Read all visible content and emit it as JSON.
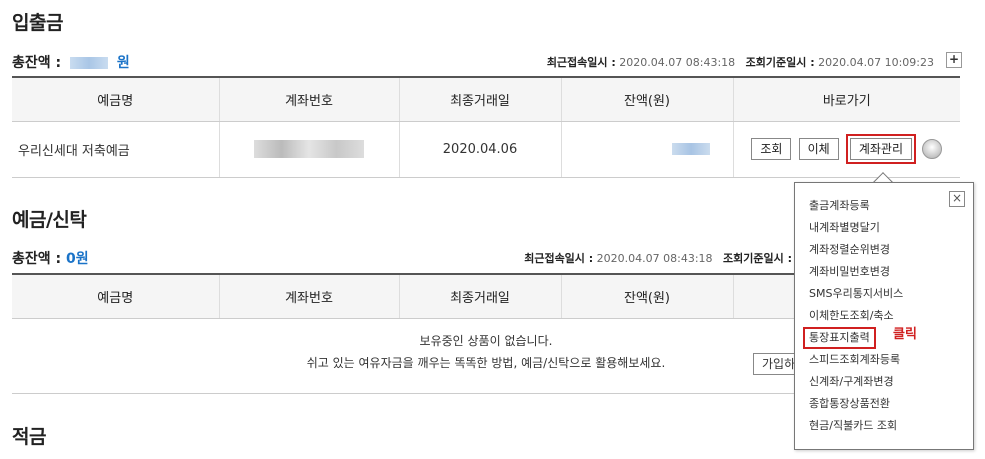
{
  "deposit_withdraw": {
    "title": "입출금",
    "total_label": "총잔액 :",
    "currency": "원",
    "last_access_label": "최근접속일시 :",
    "last_access": "2020.04.07 08:43:18",
    "query_label": "조회기준일시 :",
    "query_time": "2020.04.07 10:09:23",
    "plus": "+",
    "columns": [
      "예금명",
      "계좌번호",
      "최종거래일",
      "잔액(원)",
      "바로가기"
    ],
    "rows": [
      {
        "name": "우리신세대 저축예금",
        "last_date": "2020.04.06",
        "btn_inquiry": "조회",
        "btn_transfer": "이체",
        "btn_manage": "계좌관리"
      }
    ]
  },
  "savings_trust": {
    "title": "예금/신탁",
    "total_label": "총잔액 :",
    "total_value": "0원",
    "last_access_label": "최근접속일시 :",
    "last_access": "2020.04.07 08:43:18",
    "query_label": "조회기준일시 :",
    "columns": [
      "예금명",
      "계좌번호",
      "최종거래일",
      "잔액(원)"
    ],
    "empty_line1": "보유중인 상품이 없습니다.",
    "empty_line2": "쉬고 있는 여유자금을 깨우는 똑똑한 방법, 예금/신탁으로 활용해보세요.",
    "join_button": "가입하"
  },
  "installment": {
    "title": "적금"
  },
  "account_menu": {
    "close": "×",
    "items": [
      "출금계좌등록",
      "내계좌별명달기",
      "계좌정렬순위변경",
      "계좌비밀번호변경",
      "SMS우리통지서비스",
      "이체한도조회/축소",
      "통장표지출력",
      "스피드조회계좌등록",
      "신계좌/구계좌변경",
      "종합통장상품전환",
      "현금/직불카드 조회"
    ],
    "click_note": "클릭"
  }
}
